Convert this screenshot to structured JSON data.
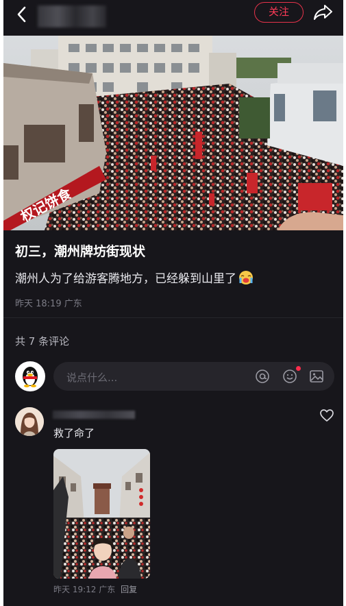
{
  "top_bar": {
    "follow_label": "关注"
  },
  "post": {
    "title": "初三，潮州牌坊街现状",
    "body": "潮州人为了给游客腾地方，已经躲到山里了",
    "time": "昨天 18:19",
    "location": "广东",
    "photo_sign_text": "权记饼食"
  },
  "comments_header": {
    "count_text": "共 7 条评论"
  },
  "comment_input": {
    "placeholder": "说点什么..."
  },
  "comments": [
    {
      "text": "救了命了",
      "time": "昨天 19:12",
      "location": "广东",
      "reply_label": "回复"
    }
  ],
  "icons": {
    "back": "chevron-left-icon",
    "share": "share-arrow-icon",
    "mention": "at-sign-icon",
    "emoji": "smiley-icon",
    "image": "image-icon",
    "like": "heart-icon"
  },
  "colors": {
    "background": "#17161b",
    "accent": "#ff3b57",
    "text_primary": "#ffffff",
    "text_secondary": "#7c7c86"
  }
}
